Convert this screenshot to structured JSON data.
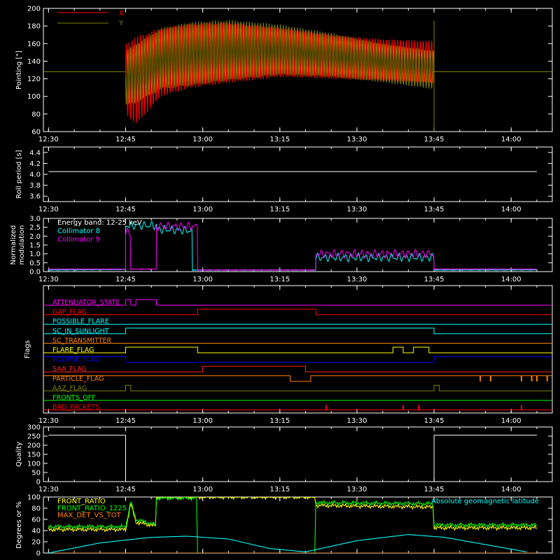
{
  "time_ticks": [
    "12:30",
    "12:45",
    "13:00",
    "13:15",
    "13:30",
    "13:45",
    "14:00"
  ],
  "chart_data": [
    {
      "type": "line",
      "panel": "pointing",
      "ylabel": "Pointing [\"]",
      "ylim": [
        60,
        200
      ],
      "yticks": [
        60,
        80,
        100,
        120,
        140,
        160,
        180,
        200
      ],
      "legend_placement": "top-left",
      "series": [
        {
          "name": "X",
          "color": "#ff0000",
          "envelope_high": {
            "x": [
              "12:45",
              "12:47",
              "12:52",
              "12:58",
              "13:05",
              "13:15",
              "13:25",
              "13:35",
              "13:45"
            ],
            "y": [
              160,
              168,
              178,
              183,
              184,
              178,
              170,
              165,
              163
            ]
          },
          "envelope_low": {
            "x": [
              "12:45",
              "12:47",
              "12:52",
              "12:58",
              "13:05",
              "13:15",
              "13:25",
              "13:35",
              "13:45"
            ],
            "y": [
              80,
              68,
              100,
              110,
              115,
              122,
              120,
              118,
              115
            ]
          },
          "flat_value": 128
        },
        {
          "name": "Y",
          "color": "#808000",
          "envelope_high": {
            "x": [
              "12:45",
              "12:47",
              "12:52",
              "12:58",
              "13:05",
              "13:15",
              "13:25",
              "13:35",
              "13:45"
            ],
            "y": [
              152,
              160,
              178,
              185,
              187,
              182,
              172,
              160,
              152
            ]
          },
          "envelope_low": {
            "x": [
              "12:45",
              "12:47",
              "12:52",
              "12:58",
              "13:05",
              "13:15",
              "13:25",
              "13:35",
              "13:45"
            ],
            "y": [
              90,
              92,
              108,
              112,
              118,
              124,
              122,
              116,
              108
            ]
          },
          "flat_value": 128
        }
      ]
    },
    {
      "type": "line",
      "panel": "roll",
      "ylabel": "Roll period [s]",
      "ylim": [
        3.5,
        4.5
      ],
      "yticks": [
        3.6,
        3.8,
        4.0,
        4.2,
        4.4
      ],
      "series": [
        {
          "color": "#ffffff",
          "x": [
            "12:30",
            "14:05"
          ],
          "y": [
            4.05,
            4.05
          ]
        }
      ]
    },
    {
      "type": "line",
      "panel": "modulation",
      "ylabel": "Normalized modulation",
      "ylim": [
        0,
        3.0
      ],
      "yticks": [
        0.0,
        0.5,
        1.0,
        1.5,
        2.0,
        2.5,
        3.0
      ],
      "title": "Energy band: 12-25 keV",
      "series": [
        {
          "name": "Collimator 8",
          "color": "#00ffff",
          "x": [
            "12:30",
            "12:45",
            "12:45",
            "12:51",
            "12:51",
            "12:58",
            "12:58",
            "13:22",
            "13:22",
            "13:45",
            "13:45",
            "14:05"
          ],
          "y": [
            0.05,
            0.08,
            2.6,
            2.6,
            2.4,
            2.3,
            0.05,
            0.05,
            0.8,
            0.8,
            0.05,
            0.06
          ]
        },
        {
          "name": "Collimator 9",
          "color": "#ff00ff",
          "x": [
            "12:30",
            "12:45",
            "12:45",
            "12:46",
            "12:46",
            "12:51",
            "12:51",
            "12:59",
            "12:59",
            "13:22",
            "13:22",
            "13:45",
            "13:45",
            "14:05"
          ],
          "y": [
            0.1,
            0.1,
            2.2,
            2.2,
            0.1,
            0.1,
            2.55,
            2.55,
            0.05,
            0.05,
            1.0,
            1.0,
            0.1,
            0.1
          ]
        }
      ]
    },
    {
      "type": "line",
      "panel": "flags",
      "ylabel": "Flags",
      "series": [
        {
          "name": "ATTENUATOR_STATE",
          "color": "#ff00ff",
          "steps": [
            [
              "12:30",
              0
            ],
            [
              "12:45",
              1
            ],
            [
              "12:46",
              0
            ],
            [
              "12:47",
              1
            ],
            [
              "12:51",
              0
            ]
          ]
        },
        {
          "name": "GAP_FLAG",
          "color": "#ff0000",
          "steps": [
            [
              "12:30",
              0
            ],
            [
              "12:59",
              1
            ],
            [
              "13:22",
              0
            ]
          ]
        },
        {
          "name": "POSSIBLE_FLARE",
          "color": "#00ffff",
          "steps": [
            [
              "12:30",
              0
            ]
          ]
        },
        {
          "name": "SC_IN_SUNLIGHT",
          "color": "#00ffff",
          "steps": [
            [
              "12:30",
              0
            ],
            [
              "12:45",
              1
            ],
            [
              "13:45",
              0
            ]
          ]
        },
        {
          "name": "SC_TRANSMITTER",
          "color": "#ff8000",
          "steps": [
            [
              "12:30",
              0
            ]
          ]
        },
        {
          "name": "FLARE_FLAG",
          "color": "#ffff00",
          "steps": [
            [
              "12:30",
              0
            ],
            [
              "12:45",
              1
            ],
            [
              "12:59",
              0
            ],
            [
              "13:37",
              1
            ],
            [
              "13:39",
              0
            ],
            [
              "13:41",
              1
            ],
            [
              "13:44",
              0
            ]
          ]
        },
        {
          "name": "ECLIPSE_FLAG",
          "color": "#0000ff",
          "steps": [
            [
              "12:30",
              1
            ],
            [
              "12:45",
              0
            ],
            [
              "13:45",
              1
            ]
          ]
        },
        {
          "name": "SAA_FLAG",
          "color": "#ff2020",
          "steps": [
            [
              "12:30",
              0
            ],
            [
              "13:00",
              1
            ],
            [
              "13:20",
              0
            ]
          ]
        },
        {
          "name": "PARTICLE_FLAG",
          "color": "#ff8000",
          "steps": [
            [
              "12:30",
              1
            ],
            [
              "13:17",
              0
            ],
            [
              "13:21",
              1
            ]
          ]
        },
        {
          "name": "AAZ_FLAG",
          "color": "#808000",
          "steps": [
            [
              "12:30",
              0
            ],
            [
              "12:45",
              1
            ],
            [
              "12:46",
              0
            ],
            [
              "13:45",
              1
            ],
            [
              "13:46",
              0
            ]
          ]
        },
        {
          "name": "FRONTS_OFF",
          "color": "#00ff00",
          "steps": [
            [
              "12:30",
              0
            ]
          ]
        },
        {
          "name": "BAD_PACKETS",
          "color": "#ff0000",
          "steps": [
            [
              "12:30",
              0
            ]
          ]
        }
      ]
    },
    {
      "type": "line",
      "panel": "quality",
      "ylabel": "Quality",
      "ylim": [
        0,
        300
      ],
      "yticks": [
        0,
        50,
        100,
        150,
        200,
        250,
        300
      ],
      "series": [
        {
          "color": "#ffffff",
          "x": [
            "12:30",
            "12:45",
            "12:45",
            "13:45",
            "13:45",
            "14:05"
          ],
          "y": [
            255,
            255,
            0,
            0,
            255,
            255
          ]
        }
      ]
    },
    {
      "type": "line",
      "panel": "ratios",
      "ylabel": "Degrees or %",
      "ylim": [
        0,
        100
      ],
      "yticks": [
        0,
        20,
        40,
        60,
        80,
        100
      ],
      "series": [
        {
          "name": "FRONT_RATIO",
          "color": "#ffff00",
          "x": [
            "12:30",
            "12:45",
            "12:46",
            "12:47",
            "12:51",
            "12:51",
            "12:59",
            "13:22",
            "13:22",
            "13:45",
            "13:45",
            "14:05"
          ],
          "y": [
            42,
            42,
            88,
            55,
            48,
            100,
            100,
            100,
            85,
            82,
            45,
            45
          ]
        },
        {
          "name": "FRONT_RATIO_1225",
          "color": "#00ff00",
          "x": [
            "12:30",
            "12:45",
            "12:46",
            "12:47",
            "12:51",
            "12:51",
            "12:59",
            "12:59",
            "13:22",
            "13:22",
            "13:45",
            "13:45",
            "14:05"
          ],
          "y": [
            47,
            47,
            92,
            60,
            50,
            98,
            98,
            0,
            0,
            90,
            88,
            50,
            50
          ]
        },
        {
          "name": "MAX_DET_VS_TOT",
          "color": "#ff8000",
          "x": [
            "12:30",
            "14:05"
          ],
          "y": [
            0,
            0
          ]
        },
        {
          "name": "Absolute geomagnetic latitude",
          "color": "#00ffff",
          "x": [
            "12:30",
            "12:40",
            "12:50",
            "12:57",
            "13:05",
            "13:13",
            "13:20",
            "13:30",
            "13:40",
            "13:47",
            "13:55",
            "14:03"
          ],
          "y": [
            0,
            18,
            28,
            30,
            25,
            8,
            2,
            22,
            33,
            28,
            15,
            2
          ]
        }
      ]
    }
  ]
}
